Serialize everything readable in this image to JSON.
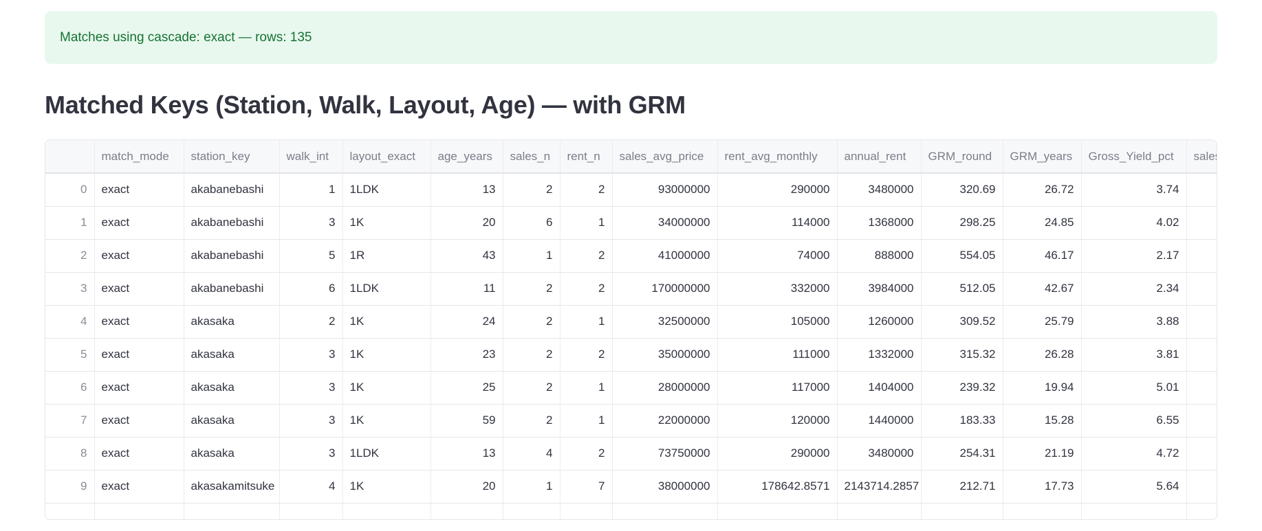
{
  "alert": {
    "text": "Matches using cascade: exact — rows: 135",
    "color": "#177233",
    "background": "#e8f8ee"
  },
  "heading": "Matched Keys (Station, Walk, Layout, Age) — with GRM",
  "table": {
    "columns": [
      "",
      "match_mode",
      "station_key",
      "walk_int",
      "layout_exact",
      "age_years",
      "sales_n",
      "rent_n",
      "sales_avg_price",
      "rent_avg_monthly",
      "annual_rent",
      "GRM_round",
      "GRM_years",
      "Gross_Yield_pct",
      "sales"
    ],
    "rows": [
      [
        "0",
        "exact",
        "akabanebashi",
        "1",
        "1LDK",
        "13",
        "2",
        "2",
        "93000000",
        "290000",
        "3480000",
        "320.69",
        "26.72",
        "3.74",
        ""
      ],
      [
        "1",
        "exact",
        "akabanebashi",
        "3",
        "1K",
        "20",
        "6",
        "1",
        "34000000",
        "114000",
        "1368000",
        "298.25",
        "24.85",
        "4.02",
        ""
      ],
      [
        "2",
        "exact",
        "akabanebashi",
        "5",
        "1R",
        "43",
        "1",
        "2",
        "41000000",
        "74000",
        "888000",
        "554.05",
        "46.17",
        "2.17",
        ""
      ],
      [
        "3",
        "exact",
        "akabanebashi",
        "6",
        "1LDK",
        "11",
        "2",
        "2",
        "170000000",
        "332000",
        "3984000",
        "512.05",
        "42.67",
        "2.34",
        ""
      ],
      [
        "4",
        "exact",
        "akasaka",
        "2",
        "1K",
        "24",
        "2",
        "1",
        "32500000",
        "105000",
        "1260000",
        "309.52",
        "25.79",
        "3.88",
        ""
      ],
      [
        "5",
        "exact",
        "akasaka",
        "3",
        "1K",
        "23",
        "2",
        "2",
        "35000000",
        "111000",
        "1332000",
        "315.32",
        "26.28",
        "3.81",
        ""
      ],
      [
        "6",
        "exact",
        "akasaka",
        "3",
        "1K",
        "25",
        "2",
        "1",
        "28000000",
        "117000",
        "1404000",
        "239.32",
        "19.94",
        "5.01",
        ""
      ],
      [
        "7",
        "exact",
        "akasaka",
        "3",
        "1K",
        "59",
        "2",
        "1",
        "22000000",
        "120000",
        "1440000",
        "183.33",
        "15.28",
        "6.55",
        ""
      ],
      [
        "8",
        "exact",
        "akasaka",
        "3",
        "1LDK",
        "13",
        "4",
        "2",
        "73750000",
        "290000",
        "3480000",
        "254.31",
        "21.19",
        "4.72",
        ""
      ],
      [
        "9",
        "exact",
        "akasakamitsuke",
        "4",
        "1K",
        "20",
        "1",
        "7",
        "38000000",
        "178642.8571",
        "2143714.2857",
        "212.71",
        "17.73",
        "5.64",
        ""
      ],
      [
        "",
        "",
        "",
        "",
        "",
        "",
        "",
        "",
        "",
        "",
        "",
        "",
        "",
        "",
        ""
      ]
    ]
  }
}
